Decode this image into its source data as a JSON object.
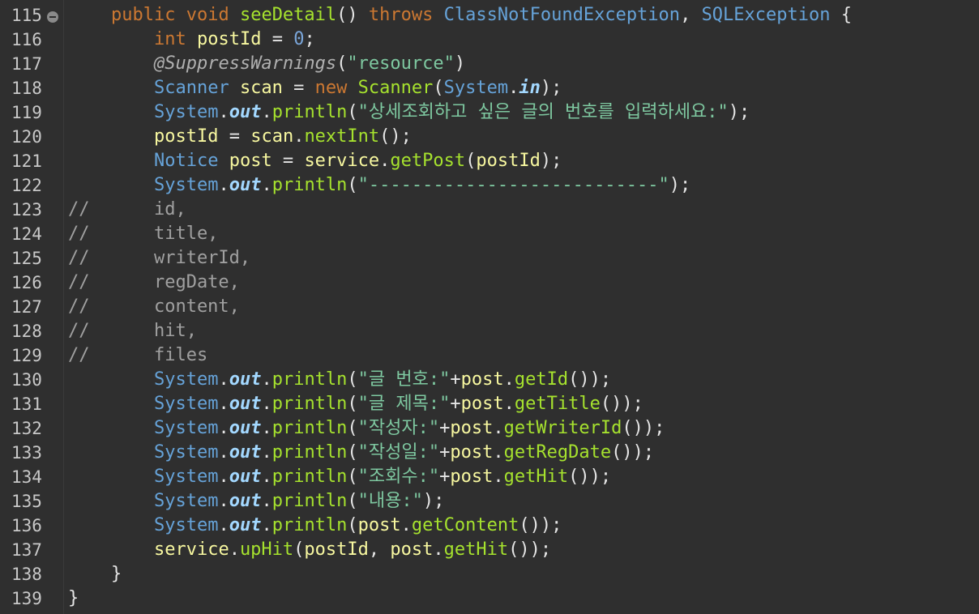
{
  "editor": {
    "lines": [
      {
        "n": "115",
        "fold": true,
        "tokens": [
          {
            "t": "    "
          },
          {
            "t": "public",
            "c": "kw"
          },
          {
            "t": " "
          },
          {
            "t": "void",
            "c": "kw"
          },
          {
            "t": " "
          },
          {
            "t": "seeDetail",
            "c": "fn"
          },
          {
            "t": "() "
          },
          {
            "t": "throws",
            "c": "kw"
          },
          {
            "t": " "
          },
          {
            "t": "ClassNotFoundException",
            "c": "ty"
          },
          {
            "t": ", "
          },
          {
            "t": "SQLException",
            "c": "ty"
          },
          {
            "t": " {"
          }
        ]
      },
      {
        "n": "116",
        "tokens": [
          {
            "t": "        "
          },
          {
            "t": "int",
            "c": "kw"
          },
          {
            "t": " "
          },
          {
            "t": "postId",
            "c": "var"
          },
          {
            "t": " = "
          },
          {
            "t": "0",
            "c": "num"
          },
          {
            "t": ";"
          }
        ]
      },
      {
        "n": "117",
        "tokens": [
          {
            "t": "        "
          },
          {
            "t": "@SuppressWarnings",
            "c": "ann"
          },
          {
            "t": "("
          },
          {
            "t": "\"resource\"",
            "c": "str"
          },
          {
            "t": ")"
          }
        ]
      },
      {
        "n": "118",
        "tokens": [
          {
            "t": "        "
          },
          {
            "t": "Scanner",
            "c": "ty"
          },
          {
            "t": " "
          },
          {
            "t": "scan",
            "c": "var"
          },
          {
            "t": " = "
          },
          {
            "t": "new",
            "c": "kw"
          },
          {
            "t": " "
          },
          {
            "t": "Scanner",
            "c": "fn"
          },
          {
            "t": "("
          },
          {
            "t": "System",
            "c": "ty"
          },
          {
            "t": "."
          },
          {
            "t": "in",
            "c": "sf"
          },
          {
            "t": ");"
          }
        ]
      },
      {
        "n": "119",
        "tokens": [
          {
            "t": "        "
          },
          {
            "t": "System",
            "c": "ty"
          },
          {
            "t": "."
          },
          {
            "t": "out",
            "c": "sf"
          },
          {
            "t": "."
          },
          {
            "t": "println",
            "c": "fn"
          },
          {
            "t": "("
          },
          {
            "t": "\"상세조회하고 싶은 글의 번호를 입력하세요:\"",
            "c": "str"
          },
          {
            "t": ");"
          }
        ]
      },
      {
        "n": "120",
        "tokens": [
          {
            "t": "        "
          },
          {
            "t": "postId",
            "c": "var"
          },
          {
            "t": " = "
          },
          {
            "t": "scan",
            "c": "var"
          },
          {
            "t": "."
          },
          {
            "t": "nextInt",
            "c": "fn"
          },
          {
            "t": "();"
          }
        ]
      },
      {
        "n": "121",
        "tokens": [
          {
            "t": "        "
          },
          {
            "t": "Notice",
            "c": "ty"
          },
          {
            "t": " "
          },
          {
            "t": "post",
            "c": "var"
          },
          {
            "t": " = "
          },
          {
            "t": "service",
            "c": "var"
          },
          {
            "t": "."
          },
          {
            "t": "getPost",
            "c": "fn"
          },
          {
            "t": "("
          },
          {
            "t": "postId",
            "c": "var"
          },
          {
            "t": ");"
          }
        ]
      },
      {
        "n": "122",
        "tokens": [
          {
            "t": "        "
          },
          {
            "t": "System",
            "c": "ty"
          },
          {
            "t": "."
          },
          {
            "t": "out",
            "c": "sf"
          },
          {
            "t": "."
          },
          {
            "t": "println",
            "c": "fn"
          },
          {
            "t": "("
          },
          {
            "t": "\"---------------------------\"",
            "c": "str"
          },
          {
            "t": ");"
          }
        ]
      },
      {
        "n": "123",
        "tokens": [
          {
            "t": "//      id,",
            "c": "cm"
          }
        ]
      },
      {
        "n": "124",
        "tokens": [
          {
            "t": "//      title,",
            "c": "cm"
          }
        ]
      },
      {
        "n": "125",
        "tokens": [
          {
            "t": "//      writerId,",
            "c": "cm"
          }
        ]
      },
      {
        "n": "126",
        "tokens": [
          {
            "t": "//      regDate,",
            "c": "cm"
          }
        ]
      },
      {
        "n": "127",
        "tokens": [
          {
            "t": "//      content,",
            "c": "cm"
          }
        ]
      },
      {
        "n": "128",
        "tokens": [
          {
            "t": "//      hit,",
            "c": "cm"
          }
        ]
      },
      {
        "n": "129",
        "tokens": [
          {
            "t": "//      files",
            "c": "cm"
          }
        ]
      },
      {
        "n": "130",
        "tokens": [
          {
            "t": "        "
          },
          {
            "t": "System",
            "c": "ty"
          },
          {
            "t": "."
          },
          {
            "t": "out",
            "c": "sf"
          },
          {
            "t": "."
          },
          {
            "t": "println",
            "c": "fn"
          },
          {
            "t": "("
          },
          {
            "t": "\"글 번호:\"",
            "c": "str"
          },
          {
            "t": "+"
          },
          {
            "t": "post",
            "c": "var"
          },
          {
            "t": "."
          },
          {
            "t": "getId",
            "c": "fn"
          },
          {
            "t": "());"
          }
        ]
      },
      {
        "n": "131",
        "tokens": [
          {
            "t": "        "
          },
          {
            "t": "System",
            "c": "ty"
          },
          {
            "t": "."
          },
          {
            "t": "out",
            "c": "sf"
          },
          {
            "t": "."
          },
          {
            "t": "println",
            "c": "fn"
          },
          {
            "t": "("
          },
          {
            "t": "\"글 제목:\"",
            "c": "str"
          },
          {
            "t": "+"
          },
          {
            "t": "post",
            "c": "var"
          },
          {
            "t": "."
          },
          {
            "t": "getTitle",
            "c": "fn"
          },
          {
            "t": "());"
          }
        ]
      },
      {
        "n": "132",
        "tokens": [
          {
            "t": "        "
          },
          {
            "t": "System",
            "c": "ty"
          },
          {
            "t": "."
          },
          {
            "t": "out",
            "c": "sf"
          },
          {
            "t": "."
          },
          {
            "t": "println",
            "c": "fn"
          },
          {
            "t": "("
          },
          {
            "t": "\"작성자:\"",
            "c": "str"
          },
          {
            "t": "+"
          },
          {
            "t": "post",
            "c": "var"
          },
          {
            "t": "."
          },
          {
            "t": "getWriterId",
            "c": "fn"
          },
          {
            "t": "());"
          }
        ]
      },
      {
        "n": "133",
        "tokens": [
          {
            "t": "        "
          },
          {
            "t": "System",
            "c": "ty"
          },
          {
            "t": "."
          },
          {
            "t": "out",
            "c": "sf"
          },
          {
            "t": "."
          },
          {
            "t": "println",
            "c": "fn"
          },
          {
            "t": "("
          },
          {
            "t": "\"작성일:\"",
            "c": "str"
          },
          {
            "t": "+"
          },
          {
            "t": "post",
            "c": "var"
          },
          {
            "t": "."
          },
          {
            "t": "getRegDate",
            "c": "fn"
          },
          {
            "t": "());"
          }
        ]
      },
      {
        "n": "134",
        "tokens": [
          {
            "t": "        "
          },
          {
            "t": "System",
            "c": "ty"
          },
          {
            "t": "."
          },
          {
            "t": "out",
            "c": "sf"
          },
          {
            "t": "."
          },
          {
            "t": "println",
            "c": "fn"
          },
          {
            "t": "("
          },
          {
            "t": "\"조회수:\"",
            "c": "str"
          },
          {
            "t": "+"
          },
          {
            "t": "post",
            "c": "var"
          },
          {
            "t": "."
          },
          {
            "t": "getHit",
            "c": "fn"
          },
          {
            "t": "());"
          }
        ]
      },
      {
        "n": "135",
        "tokens": [
          {
            "t": "        "
          },
          {
            "t": "System",
            "c": "ty"
          },
          {
            "t": "."
          },
          {
            "t": "out",
            "c": "sf"
          },
          {
            "t": "."
          },
          {
            "t": "println",
            "c": "fn"
          },
          {
            "t": "("
          },
          {
            "t": "\"내용:\"",
            "c": "str"
          },
          {
            "t": ");"
          }
        ]
      },
      {
        "n": "136",
        "tokens": [
          {
            "t": "        "
          },
          {
            "t": "System",
            "c": "ty"
          },
          {
            "t": "."
          },
          {
            "t": "out",
            "c": "sf"
          },
          {
            "t": "."
          },
          {
            "t": "println",
            "c": "fn"
          },
          {
            "t": "("
          },
          {
            "t": "post",
            "c": "var"
          },
          {
            "t": "."
          },
          {
            "t": "getContent",
            "c": "fn"
          },
          {
            "t": "());"
          }
        ]
      },
      {
        "n": "137",
        "tokens": [
          {
            "t": "        "
          },
          {
            "t": "service",
            "c": "var"
          },
          {
            "t": "."
          },
          {
            "t": "upHit",
            "c": "fn"
          },
          {
            "t": "("
          },
          {
            "t": "postId",
            "c": "var"
          },
          {
            "t": ", "
          },
          {
            "t": "post",
            "c": "var"
          },
          {
            "t": "."
          },
          {
            "t": "getHit",
            "c": "fn"
          },
          {
            "t": "());"
          }
        ]
      },
      {
        "n": "138",
        "tokens": [
          {
            "t": "    }"
          }
        ]
      },
      {
        "n": "139",
        "tokens": [
          {
            "t": "}"
          }
        ]
      }
    ]
  }
}
